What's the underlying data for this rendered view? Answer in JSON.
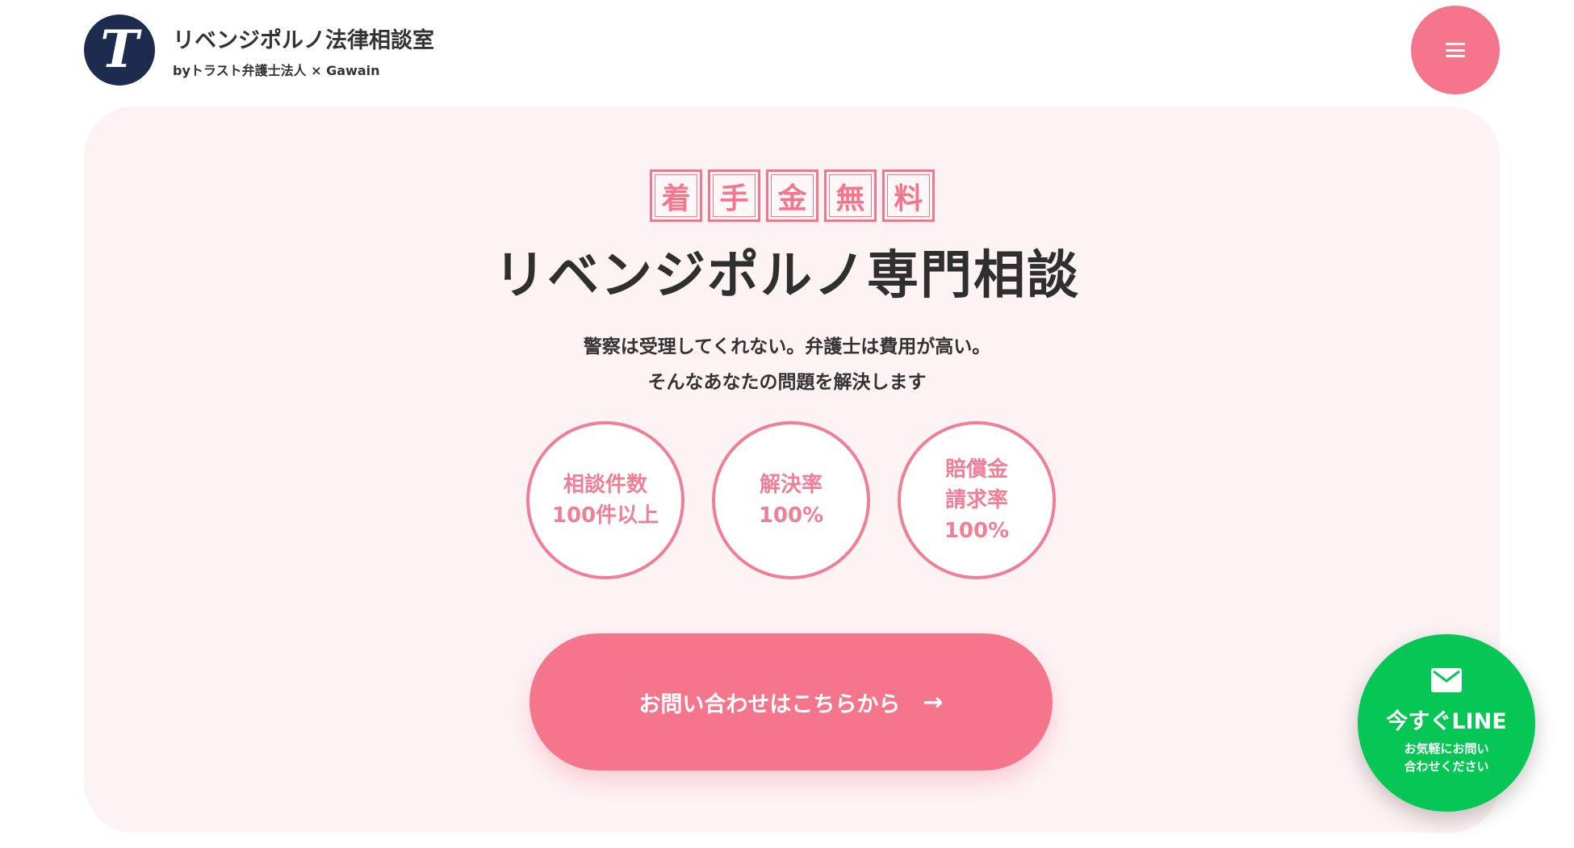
{
  "header": {
    "logo_letter": "T",
    "site_title": "リベンジポルノ法律相談室",
    "site_sub": "byトラスト弁護士法人 × Gawain"
  },
  "hero": {
    "free_badges": [
      "着",
      "手",
      "金",
      "無",
      "料"
    ],
    "title": "リベンジポルノ専門相談",
    "lead_line1": "警察は受理してくれない。弁護士は費用が高い。",
    "lead_line2": "そんなあなたの問題を解決します",
    "stats": [
      {
        "lines": [
          "相談件数",
          "100件以上"
        ]
      },
      {
        "lines": [
          "解決率",
          "100%"
        ]
      },
      {
        "lines": [
          "賠償金",
          "請求率",
          "100%"
        ]
      }
    ],
    "cta_label": "お問い合わせはこちらから",
    "cta_arrow": "→"
  },
  "line_button": {
    "title": "今すぐLINE",
    "sub_line1": "お気軽にお問い",
    "sub_line2": "合わせください"
  },
  "icons": {
    "menu": "hamburger-menu-icon",
    "mail": "mail-icon",
    "arrow": "arrow-right-icon"
  },
  "colors": {
    "accent_pink": "#f5758d",
    "hero_bg": "#fdf2f4",
    "logo_navy": "#1d2b4f",
    "line_green": "#06c755"
  }
}
